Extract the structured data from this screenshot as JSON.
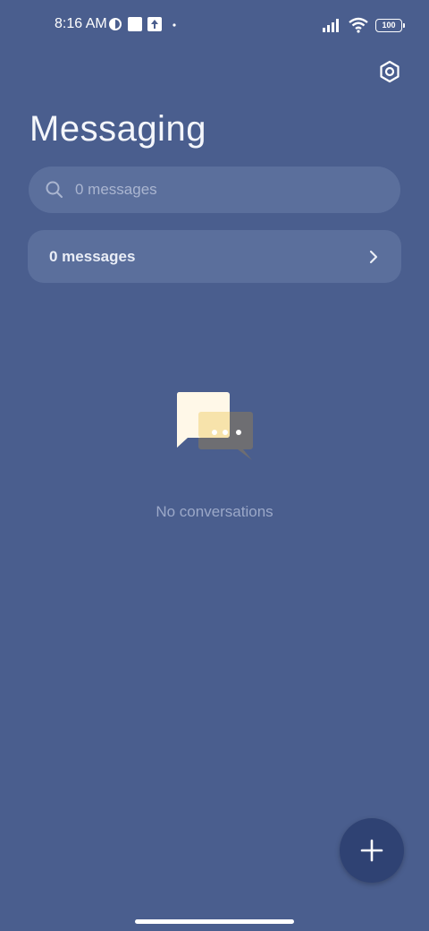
{
  "status_bar": {
    "time": "8:16 AM",
    "battery": "100",
    "icons": [
      "data-saver-icon",
      "notification-square-icon",
      "upload-icon",
      "dot-icon",
      "signal-icon",
      "wifi-icon",
      "battery-icon"
    ]
  },
  "header": {
    "title": "Messaging",
    "settings_icon": "settings-hexagon-icon"
  },
  "search": {
    "placeholder": "0 messages"
  },
  "messages_row": {
    "label": "0 messages"
  },
  "empty_state": {
    "text": "No conversations",
    "icon": "chat-bubbles-icon"
  },
  "fab": {
    "icon": "plus-icon"
  },
  "colors": {
    "background": "#4a5e8e",
    "card": "#5b6f9c",
    "fab": "#2f4273",
    "bubble_front": "#fff8e8",
    "bubble_back": "#6e6e72"
  }
}
